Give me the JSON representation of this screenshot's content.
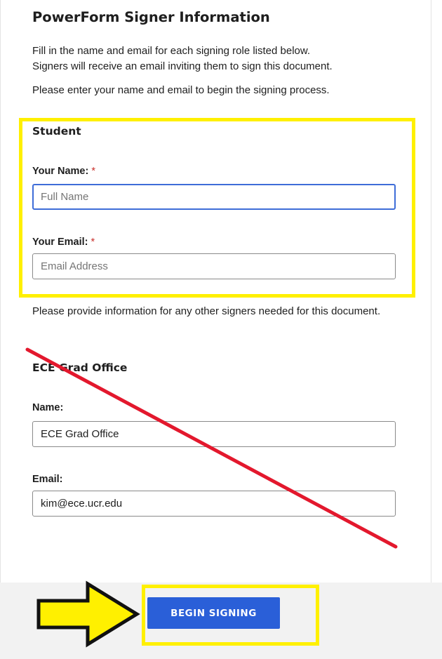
{
  "header": {
    "title": "PowerForm Signer Information"
  },
  "intro": {
    "line1": "Fill in the name and email for each signing role listed below.",
    "line2": "Signers will receive an email inviting them to sign this document.",
    "line3": "Please enter your name and email to begin the signing process."
  },
  "student": {
    "role": "Student",
    "name_label": "Your Name:",
    "name_required": "*",
    "name_placeholder": "Full Name",
    "email_label": "Your Email:",
    "email_required": "*",
    "email_placeholder": "Email Address"
  },
  "other_signers_text": "Please provide information for any other signers needed for this document.",
  "grad_office": {
    "role": "ECE Grad Office",
    "name_label": "Name:",
    "name_value": "ECE Grad Office",
    "email_label": "Email:",
    "email_value": "kim@ece.ucr.edu"
  },
  "footer": {
    "begin_label": "BEGIN SIGNING"
  },
  "annotations": {
    "highlight_color": "#fff000",
    "strike_color": "#e3182d",
    "arrow_color": "#fff000"
  },
  "colors": {
    "accent": "#2a5fd8",
    "focus": "#3e6dd8",
    "required": "#c9302c"
  }
}
